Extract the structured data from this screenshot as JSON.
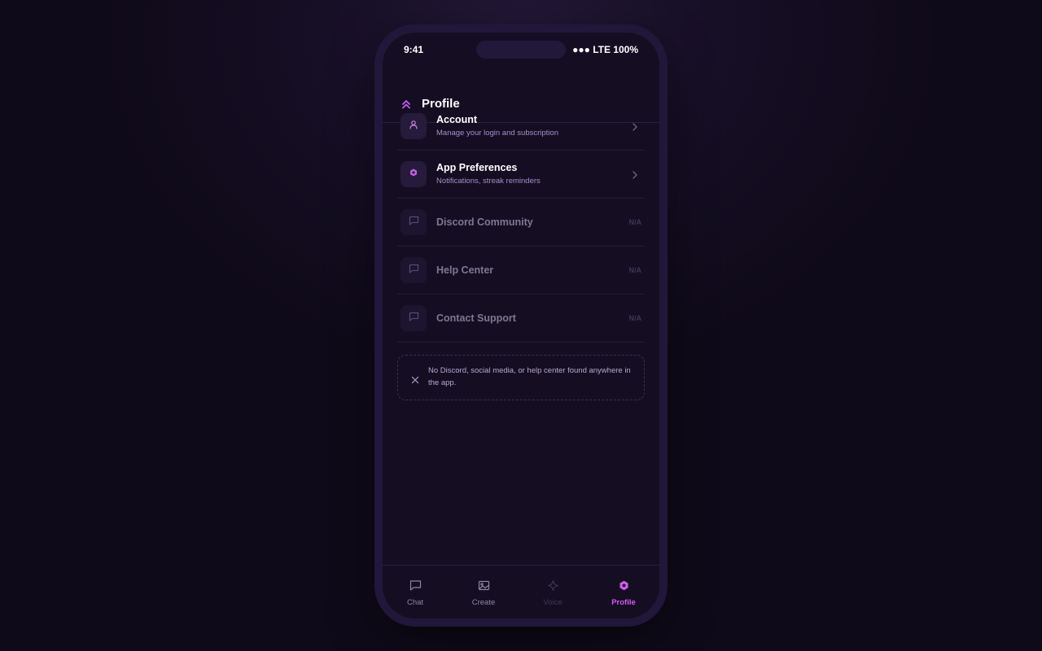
{
  "status_bar": {
    "time": "9:41",
    "right": "●●● LTE 100%"
  },
  "header": {
    "title": "Profile",
    "icon": "double-chevron-up-icon"
  },
  "menu": {
    "items": [
      {
        "title": "Account",
        "subtitle": "Manage your login and subscription",
        "icon": "user-icon",
        "enabled": true
      },
      {
        "title": "App Preferences",
        "subtitle": "Notifications, streak reminders",
        "icon": "gear-icon",
        "enabled": true
      },
      {
        "title": "Discord Community",
        "badge": "N/A",
        "icon": "chat-bubble-icon",
        "enabled": false
      },
      {
        "title": "Help Center",
        "badge": "N/A",
        "icon": "chat-bubble-icon",
        "enabled": false
      },
      {
        "title": "Contact Support",
        "badge": "N/A",
        "icon": "chat-bubble-icon",
        "enabled": false
      }
    ]
  },
  "notice": {
    "text": "No Discord, social media, or help center found anywhere in the app.",
    "icon": "close-icon"
  },
  "tabs": [
    {
      "label": "Chat",
      "icon": "chat-bubble-icon",
      "state": "normal"
    },
    {
      "label": "Create",
      "icon": "image-icon",
      "state": "normal"
    },
    {
      "label": "Voice",
      "icon": "sparkle-icon",
      "state": "disabled"
    },
    {
      "label": "Profile",
      "icon": "gear-icon",
      "state": "active"
    }
  ],
  "colors": {
    "accent": "#c35cf0",
    "active_tab": "#d45cf2",
    "background": "#150e22",
    "subtitle": "#a68fcc"
  }
}
